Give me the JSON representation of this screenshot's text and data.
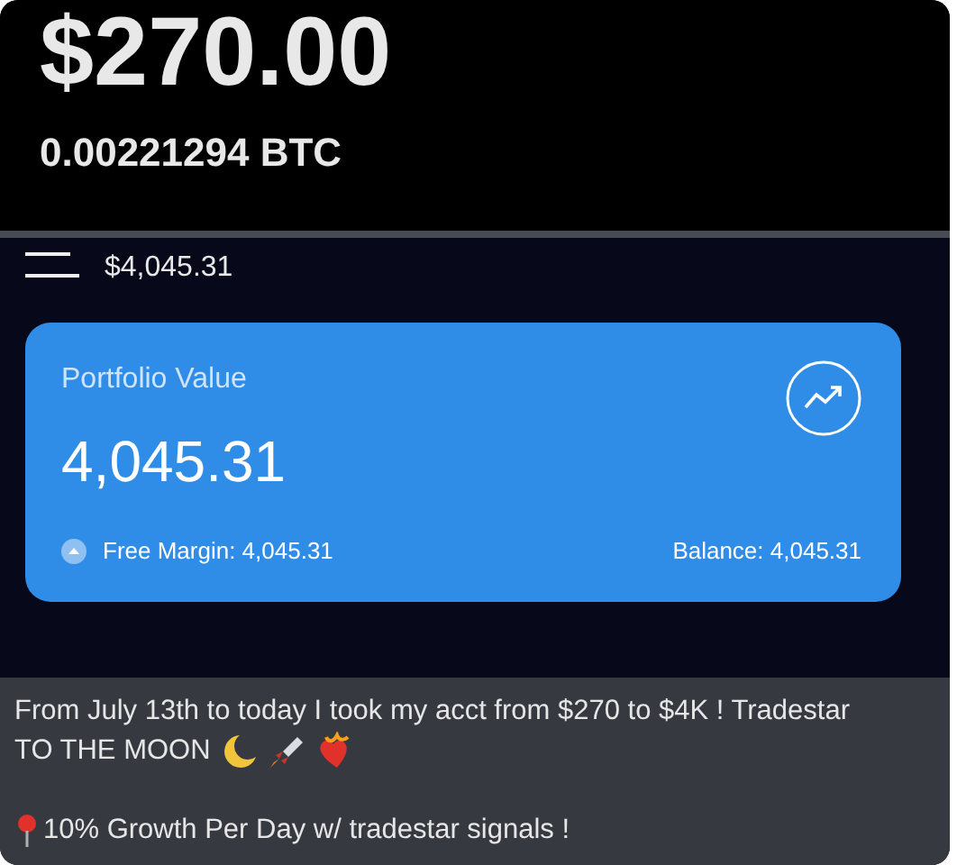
{
  "wallet": {
    "amount": "$270.00",
    "btc": "0.00221294 BTC"
  },
  "header": {
    "total": "$4,045.31"
  },
  "portfolio": {
    "title": "Portfolio Value",
    "value": "4,045.31",
    "free_margin": "Free Margin: 4,045.31",
    "balance": "Balance: 4,045.31"
  },
  "message": {
    "line_1": "From July 13th to today I took my acct from $270 to $4K ! Tradestar",
    "line_1_end": "TO THE MOON",
    "line_2": "10% Growth Per Day w/ tradestar signals !"
  }
}
